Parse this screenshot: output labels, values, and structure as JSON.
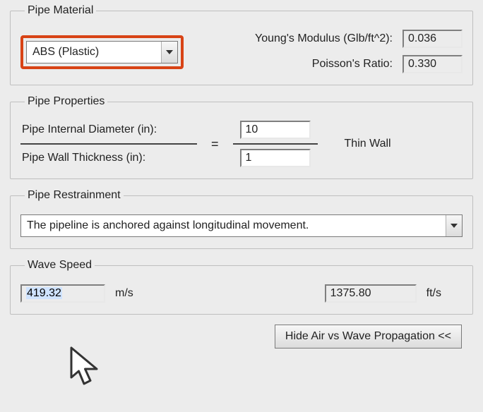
{
  "material": {
    "legend": "Pipe Material",
    "selected": "ABS (Plastic)",
    "youngs_label": "Young's Modulus (Glb/ft^2):",
    "youngs_value": "0.036",
    "poisson_label": "Poisson's Ratio:",
    "poisson_value": "0.330"
  },
  "properties": {
    "legend": "Pipe Properties",
    "diameter_label": "Pipe Internal Diameter (in):",
    "diameter_value": "10",
    "thickness_label": "Pipe Wall Thickness (in):",
    "thickness_value": "1",
    "eq": "=",
    "wall_type": "Thin Wall"
  },
  "restrainment": {
    "legend": "Pipe Restrainment",
    "selected": "The pipeline is anchored against longitudinal movement."
  },
  "wave": {
    "legend": "Wave Speed",
    "ms_value": "419.32",
    "ms_unit": "m/s",
    "fts_value": "1375.80",
    "fts_unit": "ft/s"
  },
  "buttons": {
    "hide_air": "Hide Air vs Wave Propagation <<"
  }
}
